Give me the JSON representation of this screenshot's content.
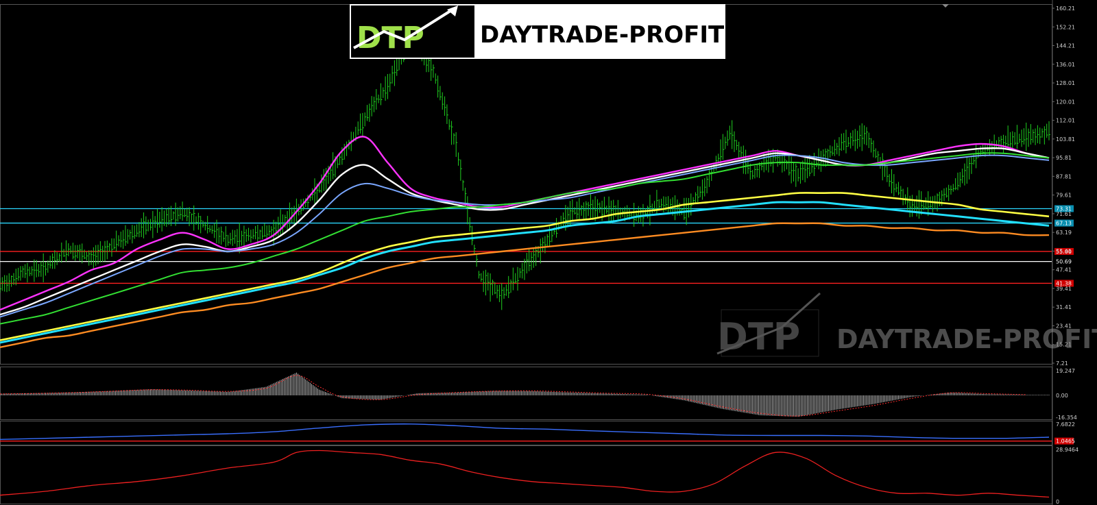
{
  "brand": {
    "logo_text": "DTP",
    "name": "DAYTRADE-PROFIT",
    "watermark_logo_text": "DTP",
    "watermark_name": "DAYTRADE-PROFIT"
  },
  "colors": {
    "background": "#000000",
    "bars": "#1fd11f",
    "ma_magenta": "#ff33ff",
    "ma_white": "#ffffff",
    "ma_lightblue": "#7aa7ff",
    "ma_green": "#33e033",
    "ma_yellow": "#ffff44",
    "ma_cyan": "#22e0ff",
    "ma_orange": "#ff8c22",
    "level_cyan": "#2ad8ff",
    "level_red": "#ff2020",
    "level_white": "#ffffff",
    "hist": "#bbbbbb",
    "signal": "#ff3030",
    "osc_blue": "#3a6fff",
    "osc_red": "#ee2020"
  },
  "chart_data": [
    {
      "type": "line",
      "panel": "price",
      "ylim": [
        7.21,
        160.21
      ],
      "ticks": [
        "160.21",
        "152.21",
        "144.21",
        "136.01",
        "128.01",
        "120.01",
        "112.01",
        "103.81",
        "95.81",
        "87.81",
        "79.61",
        "71.61",
        "63.19",
        "55.41",
        "47.41",
        "39.41",
        "31.41",
        "23.41",
        "15.21",
        "7.21"
      ],
      "x": [
        0,
        30,
        60,
        90,
        120,
        150,
        180,
        210,
        240,
        270,
        300,
        330,
        360,
        390,
        420,
        450,
        480,
        510,
        540,
        570,
        600,
        630,
        660,
        690,
        720,
        750,
        780,
        810,
        840,
        870,
        900,
        930,
        960,
        990,
        1020,
        1050,
        1080,
        1110,
        1140,
        1170,
        1200,
        1230,
        1260,
        1290,
        1320,
        1350,
        1380
      ],
      "series": [
        {
          "name": "",
          "role": "price_bars",
          "color_key": "bars",
          "values": [
            40,
            46,
            48,
            56,
            52,
            58,
            64,
            68,
            72,
            66,
            60,
            62,
            64,
            72,
            82,
            96,
            112,
            126,
            146,
            132,
            100,
            45,
            36,
            48,
            60,
            72,
            74,
            72,
            70,
            76,
            72,
            84,
            106,
            88,
            96,
            88,
            94,
            102,
            104,
            86,
            74,
            76,
            84,
            98,
            102,
            104,
            106
          ]
        },
        {
          "name": "",
          "color_key": "ma_magenta",
          "values": [
            30,
            34,
            38,
            42,
            47,
            50,
            56,
            60,
            63,
            60,
            56,
            58,
            62,
            72,
            84,
            98,
            104,
            93,
            82,
            78,
            76,
            74,
            74,
            76,
            78,
            80,
            82,
            84,
            86,
            88,
            90,
            92,
            94,
            96,
            98,
            96,
            94,
            92,
            92,
            94,
            96,
            98,
            100,
            101,
            100,
            97,
            95
          ]
        },
        {
          "name": "",
          "color_key": "ma_white",
          "values": [
            28,
            31,
            35,
            39,
            43,
            47,
            51,
            55,
            58,
            57,
            55,
            57,
            60,
            67,
            77,
            88,
            92,
            86,
            80,
            77,
            75,
            73,
            73,
            75,
            77,
            79,
            81,
            83,
            85,
            87,
            89,
            91,
            93,
            95,
            97,
            96,
            94,
            92,
            92,
            93,
            95,
            97,
            98,
            99,
            99,
            97,
            95
          ]
        },
        {
          "name": "",
          "color_key": "ma_lightblue",
          "values": [
            27,
            30,
            33,
            37,
            41,
            45,
            49,
            53,
            56,
            56,
            55,
            56,
            58,
            63,
            71,
            80,
            84,
            82,
            79,
            77,
            76,
            75,
            75,
            76,
            77,
            78,
            80,
            82,
            84,
            86,
            88,
            90,
            92,
            94,
            96,
            96,
            95,
            93,
            92,
            92,
            93,
            94,
            95,
            96,
            96,
            95,
            94
          ]
        },
        {
          "name": "",
          "color_key": "ma_green",
          "values": [
            24,
            26,
            28,
            31,
            34,
            37,
            40,
            43,
            46,
            47,
            48,
            50,
            53,
            56,
            60,
            64,
            68,
            70,
            72,
            73,
            74,
            74,
            75,
            76,
            78,
            80,
            81,
            82,
            84,
            85,
            86,
            88,
            90,
            92,
            93,
            93,
            92,
            92,
            92,
            93,
            94,
            95,
            96,
            97,
            97,
            96,
            95
          ]
        },
        {
          "name": "",
          "color_key": "ma_yellow",
          "values": [
            17,
            19,
            21,
            23,
            25,
            27,
            29,
            31,
            33,
            35,
            37,
            39,
            41,
            43,
            46,
            50,
            54,
            57,
            59,
            61,
            62,
            63,
            64,
            65,
            66,
            68,
            69,
            71,
            72,
            73,
            75,
            76,
            77,
            78,
            79,
            80,
            80,
            80,
            79,
            78,
            77,
            76,
            75,
            73,
            72,
            71,
            70
          ]
        },
        {
          "name": "",
          "color_key": "ma_cyan",
          "values": [
            16,
            18,
            20,
            22,
            24,
            26,
            28,
            30,
            32,
            34,
            36,
            38,
            40,
            42,
            45,
            48,
            52,
            55,
            57,
            59,
            60,
            61,
            62,
            63,
            64,
            66,
            67,
            68,
            70,
            71,
            72,
            73,
            74,
            75,
            76,
            76,
            76,
            75,
            74,
            73,
            72,
            71,
            70,
            69,
            68,
            67,
            66
          ]
        },
        {
          "name": "",
          "color_key": "ma_orange",
          "values": [
            14,
            16,
            18,
            19,
            21,
            23,
            25,
            27,
            29,
            30,
            32,
            33,
            35,
            37,
            39,
            42,
            45,
            48,
            50,
            52,
            53,
            54,
            55,
            56,
            57,
            58,
            59,
            60,
            61,
            62,
            63,
            64,
            65,
            66,
            67,
            67,
            67,
            66,
            66,
            65,
            65,
            64,
            64,
            63,
            63,
            62,
            62
          ]
        }
      ],
      "levels": [
        {
          "value": 73.31,
          "label": "73.31",
          "color_key": "level_cyan"
        },
        {
          "value": 67.13,
          "label": "67.13",
          "color_key": "level_cyan"
        },
        {
          "value": 55.0,
          "label": "55.00",
          "color_key": "level_red"
        },
        {
          "value": 50.69,
          "label": "50.69",
          "color_key": "level_white"
        },
        {
          "value": 41.38,
          "label": "41.38",
          "color_key": "level_red"
        }
      ]
    },
    {
      "type": "bar",
      "panel": "histogram",
      "ylim": [
        -16.354,
        19.247
      ],
      "ticks": [
        "19.247",
        "0.00",
        "-16.354"
      ],
      "x": [
        0,
        50,
        100,
        150,
        200,
        250,
        300,
        350,
        390,
        420,
        450,
        500,
        550,
        600,
        650,
        700,
        750,
        800,
        850,
        900,
        950,
        1000,
        1050,
        1100,
        1150,
        1200,
        1250,
        1300,
        1350
      ],
      "values": [
        1.2,
        1.6,
        2.2,
        3.2,
        4.3,
        3.4,
        2.4,
        6,
        16,
        4,
        -2,
        -3,
        1.5,
        2,
        3.2,
        3,
        2,
        1.2,
        0.5,
        -3.5,
        -9.5,
        -14,
        -15,
        -10,
        -6,
        -1,
        2,
        0.8,
        0.4
      ],
      "signal": [
        1.0,
        1.4,
        2.0,
        3.0,
        4.0,
        3.6,
        2.8,
        5,
        14,
        6,
        -1,
        -3,
        0.5,
        2,
        3.0,
        3.2,
        2.4,
        1.5,
        0.8,
        -2.5,
        -8,
        -12.5,
        -14.5,
        -11,
        -7,
        -2,
        1.8,
        1.2,
        0.5
      ]
    },
    {
      "type": "line",
      "panel": "osc1",
      "ylim": [
        0.0,
        7.6822
      ],
      "ticks": [
        "7.6822",
        "1.0465"
      ],
      "x": [
        0,
        60,
        120,
        180,
        240,
        300,
        360,
        420,
        480,
        540,
        600,
        660,
        720,
        780,
        840,
        900,
        960,
        1020,
        1080,
        1140,
        1200,
        1260,
        1320,
        1380
      ],
      "series": [
        {
          "name": "",
          "color_key": "osc_blue",
          "values": [
            1.6,
            2.0,
            2.4,
            2.8,
            3.2,
            3.6,
            4.3,
            5.6,
            6.7,
            7.0,
            6.4,
            5.5,
            5.2,
            4.6,
            4.1,
            3.6,
            3.1,
            3.0,
            3.0,
            2.8,
            2.3,
            2.0,
            2.0,
            2.4
          ]
        }
      ],
      "level": {
        "value": 1.0465,
        "label": "1.0465"
      }
    },
    {
      "type": "line",
      "panel": "osc2",
      "ylim": [
        0,
        28.9464
      ],
      "ticks": [
        "28.9464",
        "0"
      ],
      "x": [
        0,
        60,
        120,
        180,
        240,
        300,
        360,
        390,
        420,
        460,
        500,
        540,
        580,
        620,
        660,
        700,
        740,
        780,
        820,
        860,
        900,
        940,
        980,
        1020,
        1060,
        1100,
        1140,
        1180,
        1220,
        1260,
        1300,
        1340,
        1380
      ],
      "series": [
        {
          "name": "",
          "color_key": "osc_red",
          "values": [
            4,
            6,
            9,
            11,
            14,
            18,
            21,
            26,
            27,
            26,
            25,
            22,
            20,
            16,
            13,
            11,
            10,
            9,
            8,
            6,
            6,
            10,
            19,
            26,
            23,
            14,
            8,
            5,
            5,
            4,
            5,
            4,
            3
          ]
        }
      ]
    }
  ]
}
